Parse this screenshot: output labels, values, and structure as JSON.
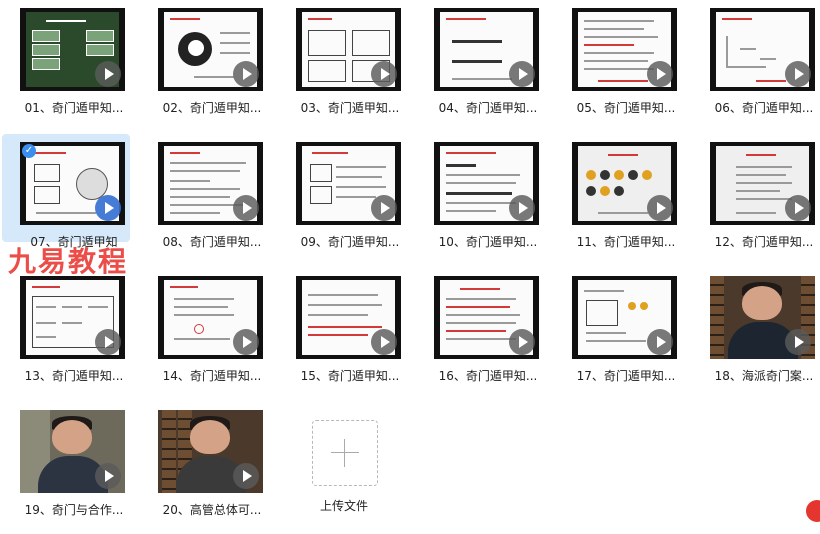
{
  "files": [
    {
      "label": "01、奇门遁甲知...",
      "kind": "slide"
    },
    {
      "label": "02、奇门遁甲知...",
      "kind": "slide"
    },
    {
      "label": "03、奇门遁甲知...",
      "kind": "slide"
    },
    {
      "label": "04、奇门遁甲知...",
      "kind": "slide"
    },
    {
      "label": "05、奇门遁甲知...",
      "kind": "slide"
    },
    {
      "label": "06、奇门遁甲知...",
      "kind": "slide"
    },
    {
      "label": "07、奇门遁甲知",
      "kind": "slide",
      "selected": true
    },
    {
      "label": "08、奇门遁甲知...",
      "kind": "slide"
    },
    {
      "label": "09、奇门遁甲知...",
      "kind": "slide"
    },
    {
      "label": "10、奇门遁甲知...",
      "kind": "slide"
    },
    {
      "label": "11、奇门遁甲知...",
      "kind": "slide"
    },
    {
      "label": "12、奇门遁甲知...",
      "kind": "slide"
    },
    {
      "label": "13、奇门遁甲知...",
      "kind": "slide"
    },
    {
      "label": "14、奇门遁甲知...",
      "kind": "slide"
    },
    {
      "label": "15、奇门遁甲知...",
      "kind": "slide"
    },
    {
      "label": "16、奇门遁甲知...",
      "kind": "slide"
    },
    {
      "label": "17、奇门遁甲知...",
      "kind": "slide"
    },
    {
      "label": "18、海派奇门案...",
      "kind": "video"
    },
    {
      "label": "19、奇门与合作...",
      "kind": "video"
    },
    {
      "label": "20、高管总体可...",
      "kind": "video"
    }
  ],
  "upload": {
    "label": "上传文件"
  },
  "watermark": {
    "text": "九易教程"
  },
  "colors": {
    "accent": "#3a8ef0",
    "watermark": "#e8302a",
    "selected_bg": "#d6e9fb"
  }
}
